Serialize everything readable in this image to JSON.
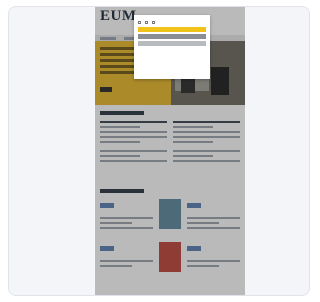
{
  "site": {
    "logo": "EUM"
  },
  "consent": {
    "title": "",
    "body": "",
    "options": [
      "",
      "",
      ""
    ],
    "accept_label": "",
    "selected_label": "",
    "reject_label": "",
    "details_link": "",
    "footer": ""
  },
  "colors": {
    "accent": "#e8b82a",
    "card_bg": "#f3f5f8"
  }
}
